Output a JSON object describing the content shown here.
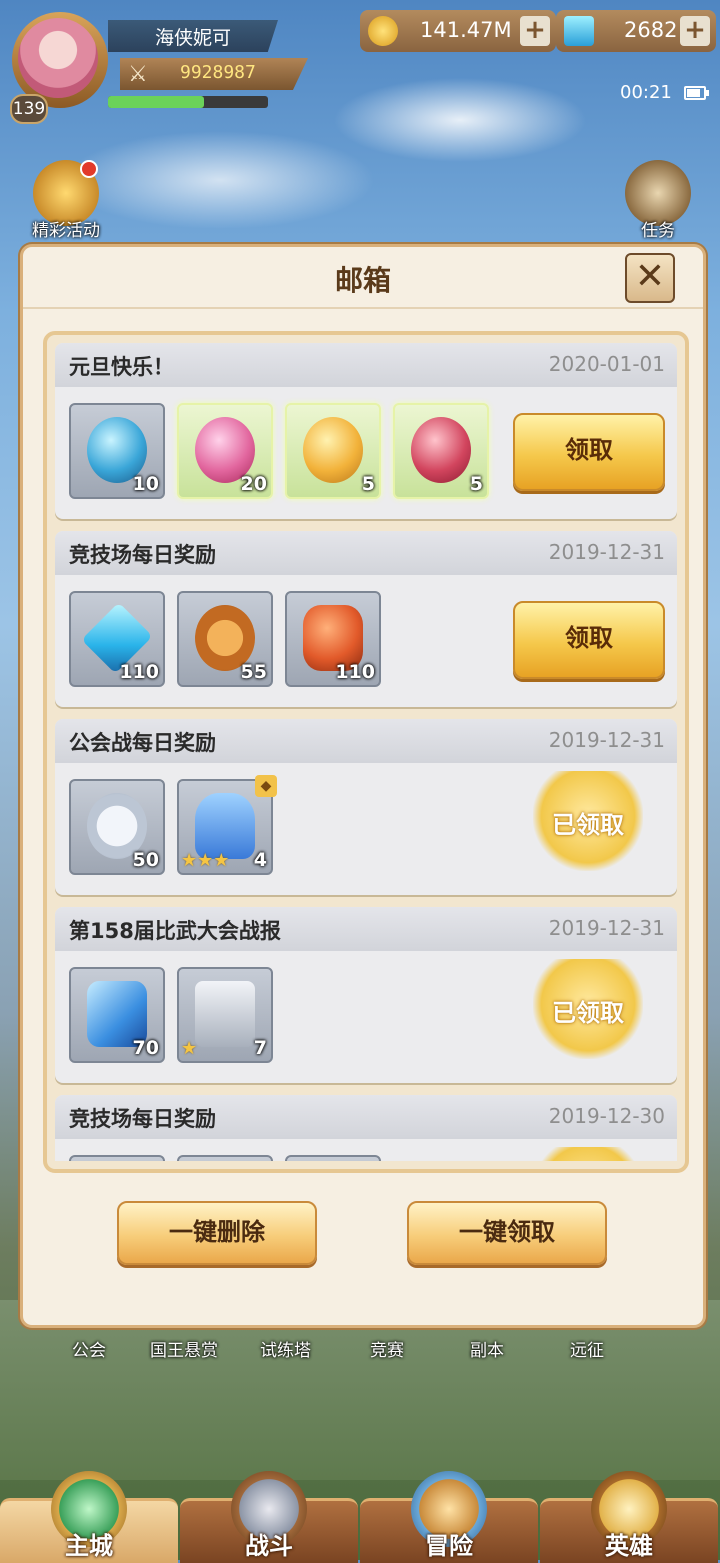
{
  "hud": {
    "player_name": "海侠妮可",
    "level": "139",
    "power": "9928987",
    "xp_fraction": 0.6,
    "gold": "141.47M",
    "gems": "2682",
    "time": "00:21"
  },
  "side_buttons": {
    "events": "精彩活动",
    "tasks": "任务"
  },
  "mailbox": {
    "title": "邮箱",
    "claim_label": "领取",
    "claimed_label": "已领取",
    "mails": [
      {
        "title": "元旦快乐！",
        "date": "2020-01-01",
        "status": "unclaimed",
        "items": [
          {
            "icon": "blue-egg-icon",
            "count": "10"
          },
          {
            "icon": "pink-egg-icon",
            "count": "20"
          },
          {
            "icon": "gold-egg-icon",
            "count": "5"
          },
          {
            "icon": "red-egg-icon",
            "count": "5"
          }
        ]
      },
      {
        "title": "竞技场每日奖励",
        "date": "2019-12-31",
        "status": "unclaimed",
        "items": [
          {
            "icon": "diamond-icon",
            "count": "110"
          },
          {
            "icon": "bronze-coin-icon",
            "count": "55"
          },
          {
            "icon": "ore-icon",
            "count": "110"
          }
        ]
      },
      {
        "title": "公会战每日奖励",
        "date": "2019-12-31",
        "status": "claimed",
        "items": [
          {
            "icon": "silver-coin-icon",
            "count": "50"
          },
          {
            "icon": "helmet-shard-icon",
            "count": "4"
          }
        ]
      },
      {
        "title": "第158届比武大会战报",
        "date": "2019-12-31",
        "status": "claimed",
        "items": [
          {
            "icon": "crystal-icon",
            "count": "70"
          },
          {
            "icon": "silver-chest-icon",
            "count": "7"
          }
        ]
      },
      {
        "title": "竞技场每日奖励",
        "date": "2019-12-30",
        "status": "claimed",
        "items": []
      }
    ],
    "delete_all": "一键删除",
    "claim_all": "一键领取"
  },
  "quick_links": [
    "公会",
    "国王悬赏",
    "试练塔",
    "竞赛",
    "副本",
    "远征"
  ],
  "nav": [
    {
      "label": "主城",
      "active": true
    },
    {
      "label": "战斗",
      "active": false
    },
    {
      "label": "冒险",
      "active": false
    },
    {
      "label": "英雄",
      "active": false
    }
  ],
  "colors": {
    "gold_button": "#f5c84b",
    "panel_bg": "#f6efe2",
    "accent_brown": "#5a3a1a"
  }
}
